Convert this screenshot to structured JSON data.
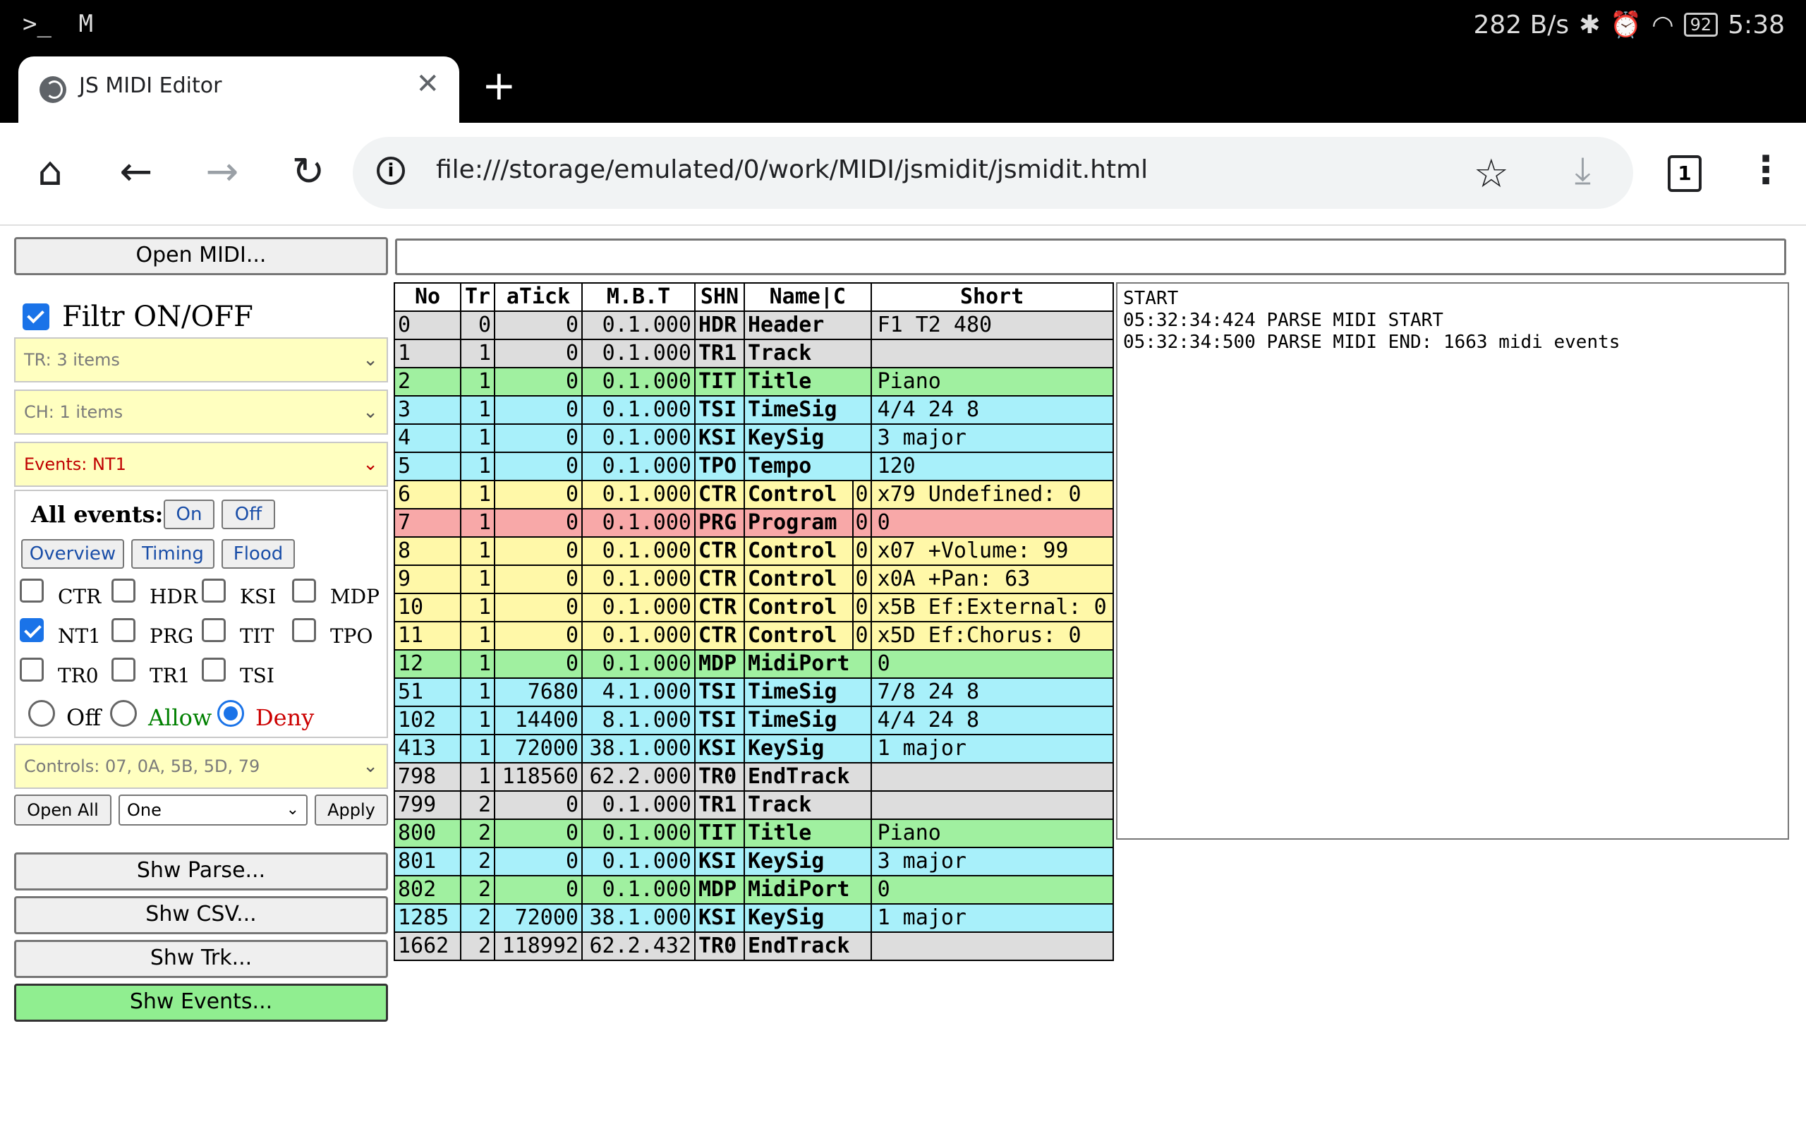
{
  "status_bar": {
    "left_icons": [
      "terminal-icon",
      "mail-icon"
    ],
    "speed": "282 B/s",
    "battery": "92",
    "time": "5:38"
  },
  "browser": {
    "tab_title": "JS MIDI Editor",
    "url": "file:///storage/emulated/0/work/MIDI/jsmidit/jsmidit.html",
    "tab_count": "1"
  },
  "left": {
    "open_midi": "Open MIDI...",
    "filtr_label": "Filtr ON/OFF",
    "filtr_checked": true,
    "tr_select": "TR: 3 items",
    "ch_select": "CH: 1 items",
    "events_select": "Events: NT1",
    "all_events": "All events:",
    "on_btn": "On",
    "off_btn": "Off",
    "overview_btn": "Overview",
    "timing_btn": "Timing",
    "flood_btn": "Flood",
    "checks": [
      {
        "label": "CTR",
        "checked": false
      },
      {
        "label": "HDR",
        "checked": false
      },
      {
        "label": "KSI",
        "checked": false
      },
      {
        "label": "MDP",
        "checked": false
      },
      {
        "label": "NT1",
        "checked": true
      },
      {
        "label": "PRG",
        "checked": false
      },
      {
        "label": "TIT",
        "checked": false
      },
      {
        "label": "TPO",
        "checked": false
      },
      {
        "label": "TR0",
        "checked": false
      },
      {
        "label": "TR1",
        "checked": false
      },
      {
        "label": "TSI",
        "checked": false
      }
    ],
    "radios": [
      {
        "label": "Off",
        "checked": false,
        "color": "#000000"
      },
      {
        "label": "Allow",
        "checked": false,
        "color": "#008000"
      },
      {
        "label": "Deny",
        "checked": true,
        "color": "#cc0000"
      }
    ],
    "controls_select": "Controls: 07, 0A, 5B, 5D, 79",
    "open_all": "Open All",
    "one_select": "One",
    "apply": "Apply",
    "shw_parse": "Shw Parse...",
    "shw_csv": "Shw CSV...",
    "shw_trk": "Shw Trk...",
    "shw_events": "Shw Events..."
  },
  "table": {
    "headers": [
      "No",
      "Tr",
      "aTick",
      "M.B.T",
      "SHN",
      "Name|C",
      "Short"
    ],
    "rows": [
      {
        "no": "0",
        "tr": "0",
        "tick": "0",
        "mbt": "0.1.000",
        "shn": "HDR",
        "name": "Header",
        "c": "",
        "short": "F1 T2 480",
        "color": "gray"
      },
      {
        "no": "1",
        "tr": "1",
        "tick": "0",
        "mbt": "0.1.000",
        "shn": "TR1",
        "name": "Track",
        "c": "",
        "short": "",
        "color": "gray"
      },
      {
        "no": "2",
        "tr": "1",
        "tick": "0",
        "mbt": "0.1.000",
        "shn": "TIT",
        "name": "Title",
        "c": "",
        "short": "Piano",
        "color": "green"
      },
      {
        "no": "3",
        "tr": "1",
        "tick": "0",
        "mbt": "0.1.000",
        "shn": "TSI",
        "name": "TimeSig",
        "c": "",
        "short": "4/4 24 8",
        "color": "cyan"
      },
      {
        "no": "4",
        "tr": "1",
        "tick": "0",
        "mbt": "0.1.000",
        "shn": "KSI",
        "name": "KeySig",
        "c": "",
        "short": "3 major",
        "color": "cyan"
      },
      {
        "no": "5",
        "tr": "1",
        "tick": "0",
        "mbt": "0.1.000",
        "shn": "TPO",
        "name": "Tempo",
        "c": "",
        "short": "120",
        "color": "cyan"
      },
      {
        "no": "6",
        "tr": "1",
        "tick": "0",
        "mbt": "0.1.000",
        "shn": "CTR",
        "name": "Control",
        "c": "0",
        "short": "x79 Undefined: 0",
        "color": "yellow"
      },
      {
        "no": "7",
        "tr": "1",
        "tick": "0",
        "mbt": "0.1.000",
        "shn": "PRG",
        "name": "Program",
        "c": "0",
        "short": "0",
        "color": "red"
      },
      {
        "no": "8",
        "tr": "1",
        "tick": "0",
        "mbt": "0.1.000",
        "shn": "CTR",
        "name": "Control",
        "c": "0",
        "short": "x07 +Volume: 99",
        "color": "yellow"
      },
      {
        "no": "9",
        "tr": "1",
        "tick": "0",
        "mbt": "0.1.000",
        "shn": "CTR",
        "name": "Control",
        "c": "0",
        "short": "x0A +Pan: 63",
        "color": "yellow"
      },
      {
        "no": "10",
        "tr": "1",
        "tick": "0",
        "mbt": "0.1.000",
        "shn": "CTR",
        "name": "Control",
        "c": "0",
        "short": "x5B Ef:External: 0",
        "color": "yellow"
      },
      {
        "no": "11",
        "tr": "1",
        "tick": "0",
        "mbt": "0.1.000",
        "shn": "CTR",
        "name": "Control",
        "c": "0",
        "short": "x5D Ef:Chorus: 0",
        "color": "yellow"
      },
      {
        "no": "12",
        "tr": "1",
        "tick": "0",
        "mbt": "0.1.000",
        "shn": "MDP",
        "name": "MidiPort",
        "c": "",
        "short": "0",
        "color": "green"
      },
      {
        "no": "51",
        "tr": "1",
        "tick": "7680",
        "mbt": "4.1.000",
        "shn": "TSI",
        "name": "TimeSig",
        "c": "",
        "short": "7/8 24 8",
        "color": "cyan"
      },
      {
        "no": "102",
        "tr": "1",
        "tick": "14400",
        "mbt": "8.1.000",
        "shn": "TSI",
        "name": "TimeSig",
        "c": "",
        "short": "4/4 24 8",
        "color": "cyan"
      },
      {
        "no": "413",
        "tr": "1",
        "tick": "72000",
        "mbt": "38.1.000",
        "shn": "KSI",
        "name": "KeySig",
        "c": "",
        "short": "1 major",
        "color": "cyan"
      },
      {
        "no": "798",
        "tr": "1",
        "tick": "118560",
        "mbt": "62.2.000",
        "shn": "TR0",
        "name": "EndTrack",
        "c": "",
        "short": "",
        "color": "gray"
      },
      {
        "no": "799",
        "tr": "2",
        "tick": "0",
        "mbt": "0.1.000",
        "shn": "TR1",
        "name": "Track",
        "c": "",
        "short": "",
        "color": "gray"
      },
      {
        "no": "800",
        "tr": "2",
        "tick": "0",
        "mbt": "0.1.000",
        "shn": "TIT",
        "name": "Title",
        "c": "",
        "short": "Piano",
        "color": "green"
      },
      {
        "no": "801",
        "tr": "2",
        "tick": "0",
        "mbt": "0.1.000",
        "shn": "KSI",
        "name": "KeySig",
        "c": "",
        "short": "3 major",
        "color": "cyan"
      },
      {
        "no": "802",
        "tr": "2",
        "tick": "0",
        "mbt": "0.1.000",
        "shn": "MDP",
        "name": "MidiPort",
        "c": "",
        "short": "0",
        "color": "green"
      },
      {
        "no": "1285",
        "tr": "2",
        "tick": "72000",
        "mbt": "38.1.000",
        "shn": "KSI",
        "name": "KeySig",
        "c": "",
        "short": "1 major",
        "color": "cyan"
      },
      {
        "no": "1662",
        "tr": "2",
        "tick": "118992",
        "mbt": "62.2.432",
        "shn": "TR0",
        "name": "EndTrack",
        "c": "",
        "short": "",
        "color": "gray"
      }
    ]
  },
  "log": {
    "lines": [
      "START",
      "05:32:34:424 PARSE MIDI START",
      "05:32:34:500 PARSE MIDI END: 1663 midi events"
    ]
  },
  "colors": {
    "row_gray": "#dddddd",
    "row_green": "#a0f0a0",
    "row_cyan": "#a8f0fa",
    "row_yellow": "#fff8a8",
    "row_red": "#f8a8a8",
    "select_bg": "#ffffc0",
    "shw_events_bg": "#90ee90"
  }
}
